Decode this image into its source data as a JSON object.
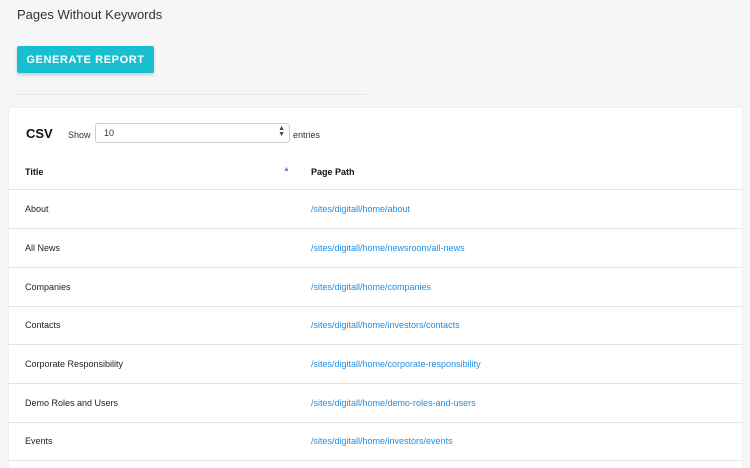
{
  "page": {
    "title": "Pages Without Keywords",
    "generate_label": "GENERATE REPORT"
  },
  "table": {
    "csv_label": "CSV",
    "show_label": "Show",
    "page_size": "10",
    "entries_label": "entries",
    "columns": [
      "Title",
      "Page Path"
    ],
    "sort_column": "Title",
    "sort_direction": "ascending",
    "rows": [
      {
        "title": "About",
        "path": "/sites/digitall/home/about"
      },
      {
        "title": "All News",
        "path": "/sites/digitall/home/newsroom/all-news"
      },
      {
        "title": "Companies",
        "path": "/sites/digitall/home/companies"
      },
      {
        "title": "Contacts",
        "path": "/sites/digitall/home/investors/contacts"
      },
      {
        "title": "Corporate Responsibility",
        "path": "/sites/digitall/home/corporate-responsibility"
      },
      {
        "title": "Demo Roles and Users",
        "path": "/sites/digitall/home/demo-roles-and-users"
      },
      {
        "title": "Events",
        "path": "/sites/digitall/home/investors/events"
      }
    ]
  },
  "colors": {
    "accent": "#17bfd1",
    "link": "#1d8ee6",
    "sort_indicator": "#6f7fcf"
  }
}
